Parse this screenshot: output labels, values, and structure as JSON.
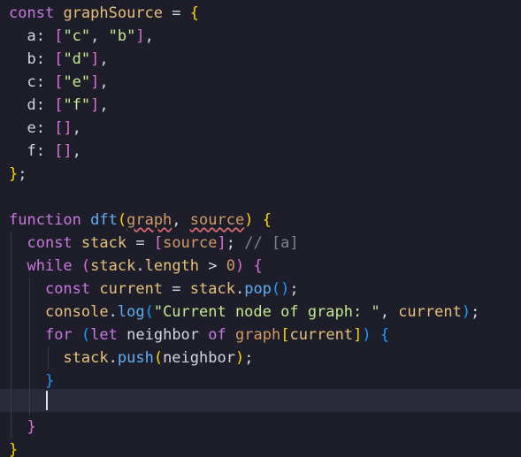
{
  "editor": {
    "lines": [
      {
        "tokens": [
          {
            "t": "const",
            "c": "k"
          },
          {
            "t": " ",
            "c": "v"
          },
          {
            "t": "graphSource",
            "c": "id"
          },
          {
            "t": " = ",
            "c": "v"
          },
          {
            "t": "{",
            "c": "br1"
          }
        ]
      },
      {
        "tokens": [
          {
            "t": "  a: ",
            "c": "v"
          },
          {
            "t": "[",
            "c": "br2"
          },
          {
            "t": "\"c\"",
            "c": "strc"
          },
          {
            "t": ", ",
            "c": "v"
          },
          {
            "t": "\"b\"",
            "c": "strc"
          },
          {
            "t": "]",
            "c": "br2"
          },
          {
            "t": ",",
            "c": "v"
          }
        ]
      },
      {
        "tokens": [
          {
            "t": "  b: ",
            "c": "v"
          },
          {
            "t": "[",
            "c": "br2"
          },
          {
            "t": "\"d\"",
            "c": "strc"
          },
          {
            "t": "]",
            "c": "br2"
          },
          {
            "t": ",",
            "c": "v"
          }
        ]
      },
      {
        "tokens": [
          {
            "t": "  c: ",
            "c": "v"
          },
          {
            "t": "[",
            "c": "br2"
          },
          {
            "t": "\"e\"",
            "c": "strc"
          },
          {
            "t": "]",
            "c": "br2"
          },
          {
            "t": ",",
            "c": "v"
          }
        ]
      },
      {
        "tokens": [
          {
            "t": "  d: ",
            "c": "v"
          },
          {
            "t": "[",
            "c": "br2"
          },
          {
            "t": "\"f\"",
            "c": "strc"
          },
          {
            "t": "]",
            "c": "br2"
          },
          {
            "t": ",",
            "c": "v"
          }
        ]
      },
      {
        "tokens": [
          {
            "t": "  e: ",
            "c": "v"
          },
          {
            "t": "[]",
            "c": "br2"
          },
          {
            "t": ",",
            "c": "v"
          }
        ]
      },
      {
        "tokens": [
          {
            "t": "  f: ",
            "c": "v"
          },
          {
            "t": "[]",
            "c": "br2"
          },
          {
            "t": ",",
            "c": "v"
          }
        ]
      },
      {
        "tokens": [
          {
            "t": "}",
            "c": "br1"
          },
          {
            "t": ";",
            "c": "v"
          }
        ]
      },
      {
        "tokens": [
          {
            "t": "",
            "c": "v"
          }
        ]
      },
      {
        "tokens": [
          {
            "t": "function",
            "c": "k"
          },
          {
            "t": " ",
            "c": "v"
          },
          {
            "t": "dft",
            "c": "f"
          },
          {
            "t": "(",
            "c": "br1"
          },
          {
            "t": "graph",
            "c": "n squig"
          },
          {
            "t": ", ",
            "c": "v"
          },
          {
            "t": "source",
            "c": "n squig"
          },
          {
            "t": ")",
            "c": "br1"
          },
          {
            "t": " ",
            "c": "v"
          },
          {
            "t": "{",
            "c": "br1"
          }
        ]
      },
      {
        "tokens": [
          {
            "t": "  ",
            "c": "v"
          },
          {
            "t": "const",
            "c": "k"
          },
          {
            "t": " ",
            "c": "v"
          },
          {
            "t": "stack",
            "c": "id"
          },
          {
            "t": " = ",
            "c": "v"
          },
          {
            "t": "[",
            "c": "br2"
          },
          {
            "t": "source",
            "c": "n"
          },
          {
            "t": "]",
            "c": "br2"
          },
          {
            "t": "; ",
            "c": "v"
          },
          {
            "t": "// [a]",
            "c": "cm"
          }
        ]
      },
      {
        "tokens": [
          {
            "t": "  ",
            "c": "v"
          },
          {
            "t": "while",
            "c": "k"
          },
          {
            "t": " ",
            "c": "v"
          },
          {
            "t": "(",
            "c": "br2"
          },
          {
            "t": "stack",
            "c": "id"
          },
          {
            "t": ".",
            "c": "v"
          },
          {
            "t": "length",
            "c": "id"
          },
          {
            "t": " > ",
            "c": "v"
          },
          {
            "t": "0",
            "c": "n"
          },
          {
            "t": ")",
            "c": "br2"
          },
          {
            "t": " ",
            "c": "v"
          },
          {
            "t": "{",
            "c": "br2"
          }
        ]
      },
      {
        "tokens": [
          {
            "t": "    ",
            "c": "v"
          },
          {
            "t": "const",
            "c": "k"
          },
          {
            "t": " ",
            "c": "v"
          },
          {
            "t": "current",
            "c": "id"
          },
          {
            "t": " = ",
            "c": "v"
          },
          {
            "t": "stack",
            "c": "id"
          },
          {
            "t": ".",
            "c": "v"
          },
          {
            "t": "pop",
            "c": "f"
          },
          {
            "t": "()",
            "c": "br3"
          },
          {
            "t": ";",
            "c": "v"
          }
        ]
      },
      {
        "tokens": [
          {
            "t": "    ",
            "c": "v"
          },
          {
            "t": "console",
            "c": "id"
          },
          {
            "t": ".",
            "c": "v"
          },
          {
            "t": "log",
            "c": "f"
          },
          {
            "t": "(",
            "c": "br3"
          },
          {
            "t": "\"Current node of graph: \"",
            "c": "strc"
          },
          {
            "t": ", ",
            "c": "v"
          },
          {
            "t": "current",
            "c": "id"
          },
          {
            "t": ")",
            "c": "br3"
          },
          {
            "t": ";",
            "c": "v"
          }
        ]
      },
      {
        "tokens": [
          {
            "t": "    ",
            "c": "v"
          },
          {
            "t": "for",
            "c": "k"
          },
          {
            "t": " ",
            "c": "v"
          },
          {
            "t": "(",
            "c": "br3"
          },
          {
            "t": "let",
            "c": "k"
          },
          {
            "t": " ",
            "c": "v"
          },
          {
            "t": "neighbor",
            "c": "v"
          },
          {
            "t": " ",
            "c": "v"
          },
          {
            "t": "of",
            "c": "k"
          },
          {
            "t": " ",
            "c": "v"
          },
          {
            "t": "graph",
            "c": "n"
          },
          {
            "t": "[",
            "c": "br1"
          },
          {
            "t": "current",
            "c": "id"
          },
          {
            "t": "]",
            "c": "br1"
          },
          {
            "t": ")",
            "c": "br3"
          },
          {
            "t": " ",
            "c": "v"
          },
          {
            "t": "{",
            "c": "br3"
          }
        ]
      },
      {
        "tokens": [
          {
            "t": "      ",
            "c": "v"
          },
          {
            "t": "stack",
            "c": "id"
          },
          {
            "t": ".",
            "c": "v"
          },
          {
            "t": "push",
            "c": "f"
          },
          {
            "t": "(",
            "c": "br1"
          },
          {
            "t": "neighbor",
            "c": "v"
          },
          {
            "t": ")",
            "c": "br1"
          },
          {
            "t": ";",
            "c": "v"
          }
        ]
      },
      {
        "tokens": [
          {
            "t": "    ",
            "c": "v"
          },
          {
            "t": "}",
            "c": "br3"
          }
        ]
      },
      {
        "tokens": [
          {
            "t": "",
            "c": "v"
          }
        ]
      },
      {
        "tokens": [
          {
            "t": "  ",
            "c": "v"
          },
          {
            "t": "}",
            "c": "br2"
          }
        ]
      },
      {
        "tokens": [
          {
            "t": "}",
            "c": "br1"
          }
        ]
      }
    ]
  }
}
